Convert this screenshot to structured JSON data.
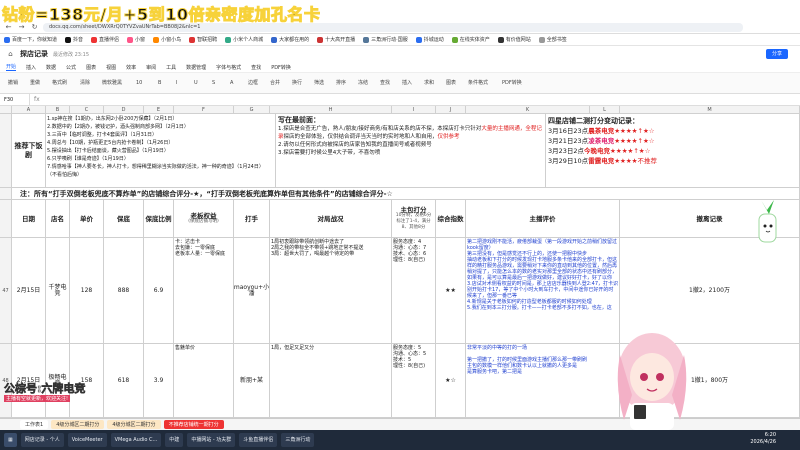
{
  "banner": {
    "text": "钻粉=138元/月+5到10倍亲密度加孔名卡"
  },
  "browser": {
    "url": "docs.qq.com/sheet/DWXRrQ0TYVZvaUNrTab=BB08J2&nlc=1",
    "bookmarks": [
      "百度一下，你就知道",
      "抖音",
      "直播伴侣",
      "小窗",
      "小窗小鸟",
      "智联招聘",
      "小米个人商城",
      "大家都在用的",
      "十大高开直播",
      "三角洲行动·国服",
      "抖城运动",
      "在线实体资产",
      "有价值网站",
      "全部书签"
    ]
  },
  "doc": {
    "title": "探店记录",
    "share_label": "分享",
    "status": "最近修改 23:15",
    "menu": [
      "开始",
      "插入",
      "数据",
      "公式",
      "图表",
      "视图",
      "效率",
      "审阅",
      "工具",
      "数据管理",
      "字体与格式",
      "查找",
      "PDF转换"
    ],
    "menu_active": 0,
    "cell_ref": "F30",
    "toolbar": [
      "撤销",
      "重做",
      "格式刷",
      "清除",
      "微软雅黑",
      "10",
      "B",
      "I",
      "U",
      "S",
      "A",
      "边框",
      "合并",
      "换行",
      "筛选",
      "排序",
      "冻结",
      "查找",
      "插入",
      "求和",
      "图表",
      "条件格式",
      "PDF转换"
    ]
  },
  "columns": [
    "A",
    "B",
    "C",
    "D",
    "E",
    "F",
    "G",
    "H",
    "I",
    "J",
    "K",
    "L",
    "M"
  ],
  "row_numbers": [
    "47",
    "48"
  ],
  "notes": {
    "recommend_label": "推荐下饭剧",
    "recommend_list": [
      "1.sp神在搜【1期办，出东网2小卧200万保藏】（2月1日）",
      "2.数据中的【2期办，被钱记护，酒头强制商部多网】（2月1日）",
      "3.三百中【临时调整，打卡4套属评】（1月31日）",
      "4.周总与【10期，护瓶更正5台内抢卡卷制】（1月26日）",
      "5.摆设抽出【打卡后结面谈，藏火营图品】（1月19日）",
      "6.只学咦刷【谁是奇迹】（1月19日）",
      "7.情感哈事【神人要冬长，神人打卡，想得稀里糊涂当实际做的活法，神一种的奇迹】（1月24日）",
      "（不看怕后悔）"
    ],
    "front_title": "写在最前面：",
    "front_text_1": "1.探店是合查无广告，熟人/朋友/接好商务/有和店关系的店不探，本探店打卡只针对",
    "front_red_1": "大量的主播网通，全程记录",
    "front_text_2": "探店的全部体验，仅供结合调评当天当时的实时地和人和自用，",
    "front_red_2": "仅供参考",
    "front_text_3": "2.请勿以任何形式向被探店的店家告知我的直播间号或者视频号",
    "front_text_4": "3.探店需要打时候公里4大子带，不喜勿喷",
    "score_title": "四星店铺二测打分变动记录：",
    "score_lines": [
      {
        "date": "3月16日23点",
        "name": "晨茶电竞",
        "stars": "★★★★↑★☆"
      },
      {
        "date": "3月21日23点",
        "name": "凌茶电竞",
        "stars": "★★★★↑★☆"
      },
      {
        "date": "3月23日2点",
        "name": "今晚电竞",
        "stars": "★★★★↑★☆"
      },
      {
        "date": "3月29日10点",
        "name": "雷霆电竞",
        "stars": "★★★★不推荐"
      }
    ],
    "note_line": "注：所有“打手双倒老板兜底不算炸单”的店铺综合评分-★，“打手双倒老板兜底算炸单但有其他条件”的店铺综合评分-☆"
  },
  "headers": {
    "date": "日期",
    "store": "店名",
    "price": "单价",
    "guarantee": "保底",
    "guarantee_ratio": "保底比例",
    "boss_benefit": "老板权益",
    "boss_benefit_sub": "(保底店铺写明)",
    "player": "打手",
    "battle": "对局战况",
    "bag_line": "主包打分",
    "bag_sub": "10分制，及格6分 标注了1-4，满分8、其他8分",
    "overall": "综合指数",
    "anchor": "主播评价",
    "withdraw": "撤离记录"
  },
  "rows": [
    {
      "date": "2月15日",
      "store": "千梦电竞",
      "price": "128",
      "guarantee": "888",
      "ratio": "6.9",
      "benefit": "卡：达击卡\n去包嫌：一零保底\n老板本人量：一零保底",
      "player": "maoyou+小潘",
      "battle": "1局初衷跟踪带领航创断中途去了\n2局之我的带标全不带领+跳地正常不提送\n3局：超世大罚了，喝最越个待定的带",
      "bag": "服务态度：4\n沟通：心态：7\n技术、心态：6\n理性：8(自己)",
      "overall": "★★",
      "review": "第二把游戏刚不能活，疲倦部裁蛋（第一段游戏开始之前稍们放留过kook留度）\n第三把没有，但是感觉还不行上的，还使一把服中快步\n抽动老板和下打分的时候发现打卡地服多条卡他来的全部打卡，但这样的精打服务品游戏，需要稍对下来你的直动到其他的位置，然后再稍对提了，只能怎么本的数的老实对那里全部的状态中还有刷部分，如果有，是可以算是最后一把游戏做好，建议好好打卡，好了以你\n3.店试对术侧看权益的时间是，那上店店乐器快到人登2:47，打卡识别开始打卡17，等了中个小时大到车打卡，中间中途你已好开的时候来了，但那一番已等\n4.新规是关于老板如何的打造型老板都服的时候如何处理\n5.我们在到本三打分服。打卡——打卡老部不多打不如，也在，这",
      "withdraw": "1撤2，2100万"
    },
    {
      "date": "2月15日",
      "store": "极畅电竞",
      "price": "158",
      "guarantee": "618",
      "ratio": "3.9",
      "benefit": "售魅单价",
      "player": "新朋+某",
      "battle": "1局，但足又足又分",
      "bag": "服务态度：5\n沟通、心态：5\n技术：5\n理性：8(自己)",
      "overall": "★☆",
      "review": "非常平淡的中等的打的一场\n\n第一把撤了，打的时候里面游戏主播们那么那一带刷刷\n主包的数模一样他们和数卡认以上就撤的人更多是\n是算服务卡吧，第二把是",
      "withdraw": "1撤1，800万"
    }
  ],
  "sheet_tabs": [
    "工作表1",
    "4级分城区二期打分",
    "4级分城区二期打分",
    "不推荐店铺统一期打分"
  ],
  "taskbar": {
    "items": [
      "网店记录 - 个人",
      "VoiceMeeter",
      "VMega Audio C...",
      "中建",
      "中播网站 - 功夫群",
      "斗鱼直播伴侣",
      "三角洲行动"
    ],
    "time": "6:20",
    "date": "2026/4/26"
  },
  "overlay": {
    "watermark": "公棕号:六牌电竞",
    "watermark_sub": "主播有空就更新，欢迎关注!"
  },
  "colors": {
    "accent": "#1a66ff",
    "red": "#e02020",
    "pink": "#e0206c",
    "taskbar": "#1f2a3a"
  }
}
